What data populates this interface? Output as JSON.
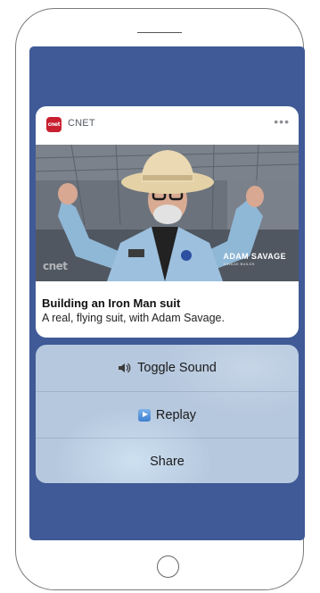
{
  "notification": {
    "app_icon_text": "cnet",
    "app_name": "CNET",
    "more_glyph": "•••",
    "video": {
      "watermark": "cnet",
      "lower_third_name": "ADAM SAVAGE",
      "lower_third_sub": "SAVAGE BUILDS"
    },
    "title": "Building an Iron Man suit",
    "body": "A real, flying suit, with Adam Savage."
  },
  "actions": [
    {
      "label": "Toggle Sound",
      "icon": "speaker-icon"
    },
    {
      "label": "Replay",
      "icon": "play-icon"
    },
    {
      "label": "Share",
      "icon": ""
    }
  ],
  "colors": {
    "screen_background": "#3f5a96",
    "app_icon": "#c8202f",
    "action_sheet": "#b6c8de"
  }
}
